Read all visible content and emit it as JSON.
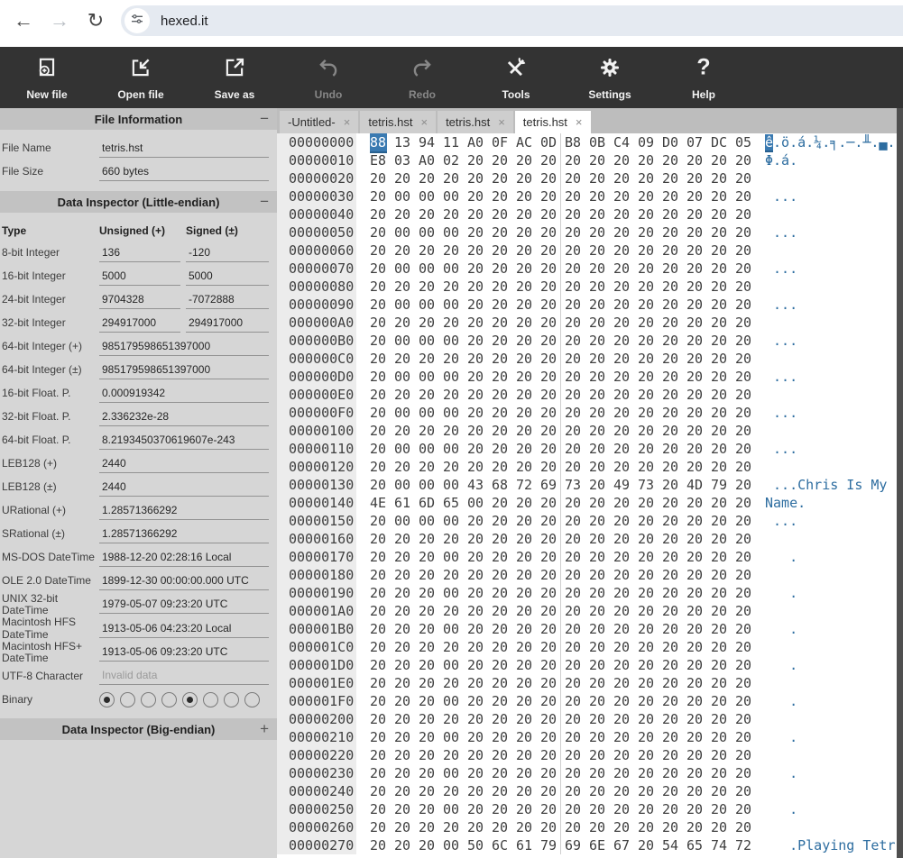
{
  "browser": {
    "url": "hexed.it"
  },
  "toolbar": {
    "buttons": [
      {
        "label": "New file",
        "icon": "new-file-icon",
        "enabled": true
      },
      {
        "label": "Open file",
        "icon": "open-file-icon",
        "enabled": true
      },
      {
        "label": "Save as",
        "icon": "save-as-icon",
        "enabled": true
      },
      {
        "label": "Undo",
        "icon": "undo-icon",
        "enabled": false
      },
      {
        "label": "Redo",
        "icon": "redo-icon",
        "enabled": false
      },
      {
        "label": "Tools",
        "icon": "tools-icon",
        "enabled": true
      },
      {
        "label": "Settings",
        "icon": "settings-icon",
        "enabled": true
      },
      {
        "label": "Help",
        "icon": "help-icon",
        "enabled": true
      }
    ]
  },
  "tabs": [
    {
      "label": "-Untitled-",
      "active": false
    },
    {
      "label": "tetris.hst",
      "active": false
    },
    {
      "label": "tetris.hst",
      "active": false
    },
    {
      "label": "tetris.hst",
      "active": true
    }
  ],
  "sidebar": {
    "file_info": {
      "title": "File Information",
      "toggle": "−",
      "rows": [
        {
          "label": "File Name",
          "value": "tetris.hst"
        },
        {
          "label": "File Size",
          "value": "660 bytes"
        }
      ]
    },
    "inspector_le": {
      "title": "Data Inspector (Little-endian)",
      "toggle": "−",
      "columns": [
        "Type",
        "Unsigned (+)",
        "Signed (±)"
      ],
      "rows": [
        {
          "label": "8-bit Integer",
          "u": "136",
          "s": "-120"
        },
        {
          "label": "16-bit Integer",
          "u": "5000",
          "s": "5000"
        },
        {
          "label": "24-bit Integer",
          "u": "9704328",
          "s": "-7072888"
        },
        {
          "label": "32-bit Integer",
          "u": "294917000",
          "s": "294917000"
        },
        {
          "label": "64-bit Integer (+)",
          "value": "985179598651397000"
        },
        {
          "label": "64-bit Integer (±)",
          "value": "985179598651397000"
        },
        {
          "label": "16-bit Float. P.",
          "value": "0.000919342"
        },
        {
          "label": "32-bit Float. P.",
          "value": "2.336232e-28"
        },
        {
          "label": "64-bit Float. P.",
          "value": "8.2193450370619607e-243"
        },
        {
          "label": "LEB128 (+)",
          "value": "2440"
        },
        {
          "label": "LEB128 (±)",
          "value": "2440"
        },
        {
          "label": "URational (+)",
          "value": "1.28571366292"
        },
        {
          "label": "SRational (±)",
          "value": "1.28571366292"
        },
        {
          "label": "MS-DOS DateTime",
          "value": "1988-12-20 02:28:16 Local"
        },
        {
          "label": "OLE 2.0 DateTime",
          "value": "1899-12-30 00:00:00.000 UTC"
        },
        {
          "label": "UNIX 32-bit DateTime",
          "value": "1979-05-07 09:23:20 UTC"
        },
        {
          "label": "Macintosh HFS DateTime",
          "value": "1913-05-06 04:23:20 Local"
        },
        {
          "label": "Macintosh HFS+ DateTime",
          "value": "1913-05-06 09:23:20 UTC"
        },
        {
          "label": "UTF-8 Character",
          "value": "Invalid data",
          "muted": true
        }
      ]
    },
    "binary": {
      "label": "Binary",
      "bits": [
        1,
        0,
        0,
        0,
        1,
        0,
        0,
        0
      ]
    },
    "inspector_be": {
      "title": "Data Inspector (Big-endian)",
      "toggle": "+"
    }
  },
  "hex_view": {
    "selection": {
      "row": 0,
      "col": 0
    },
    "colors": {
      "selection": "#3a7ab1",
      "ascii_text": "#2d6da0"
    },
    "rows": [
      [
        "00000000",
        "88 13 94 11 A0 0F AC 0D B8 0B C4 09 D0 07 DC 05",
        "ê.ö.á.¼.╕.─.╨.▄."
      ],
      [
        "00000010",
        "E8 03 A0 02 20 20 20 20 20 20 20 20 20 20 20 20",
        "Φ.á.            "
      ],
      [
        "00000020",
        "20 20 20 20 20 20 20 20 20 20 20 20 20 20 20 20",
        "                "
      ],
      [
        "00000030",
        "20 00 00 00 20 20 20 20 20 20 20 20 20 20 20 20",
        " ...            "
      ],
      [
        "00000040",
        "20 20 20 20 20 20 20 20 20 20 20 20 20 20 20 20",
        "                "
      ],
      [
        "00000050",
        "20 00 00 00 20 20 20 20 20 20 20 20 20 20 20 20",
        " ...            "
      ],
      [
        "00000060",
        "20 20 20 20 20 20 20 20 20 20 20 20 20 20 20 20",
        "                "
      ],
      [
        "00000070",
        "20 00 00 00 20 20 20 20 20 20 20 20 20 20 20 20",
        " ...            "
      ],
      [
        "00000080",
        "20 20 20 20 20 20 20 20 20 20 20 20 20 20 20 20",
        "                "
      ],
      [
        "00000090",
        "20 00 00 00 20 20 20 20 20 20 20 20 20 20 20 20",
        " ...            "
      ],
      [
        "000000A0",
        "20 20 20 20 20 20 20 20 20 20 20 20 20 20 20 20",
        "                "
      ],
      [
        "000000B0",
        "20 00 00 00 20 20 20 20 20 20 20 20 20 20 20 20",
        " ...            "
      ],
      [
        "000000C0",
        "20 20 20 20 20 20 20 20 20 20 20 20 20 20 20 20",
        "                "
      ],
      [
        "000000D0",
        "20 00 00 00 20 20 20 20 20 20 20 20 20 20 20 20",
        " ...            "
      ],
      [
        "000000E0",
        "20 20 20 20 20 20 20 20 20 20 20 20 20 20 20 20",
        "                "
      ],
      [
        "000000F0",
        "20 00 00 00 20 20 20 20 20 20 20 20 20 20 20 20",
        " ...            "
      ],
      [
        "00000100",
        "20 20 20 20 20 20 20 20 20 20 20 20 20 20 20 20",
        "                "
      ],
      [
        "00000110",
        "20 00 00 00 20 20 20 20 20 20 20 20 20 20 20 20",
        " ...            "
      ],
      [
        "00000120",
        "20 20 20 20 20 20 20 20 20 20 20 20 20 20 20 20",
        "                "
      ],
      [
        "00000130",
        "20 00 00 00 43 68 72 69 73 20 49 73 20 4D 79 20",
        " ...Chris Is My "
      ],
      [
        "00000140",
        "4E 61 6D 65 00 20 20 20 20 20 20 20 20 20 20 20",
        "Name.           "
      ],
      [
        "00000150",
        "20 00 00 00 20 20 20 20 20 20 20 20 20 20 20 20",
        " ...            "
      ],
      [
        "00000160",
        "20 20 20 20 20 20 20 20 20 20 20 20 20 20 20 20",
        "                "
      ],
      [
        "00000170",
        "20 20 20 00 20 20 20 20 20 20 20 20 20 20 20 20",
        "   .            "
      ],
      [
        "00000180",
        "20 20 20 20 20 20 20 20 20 20 20 20 20 20 20 20",
        "                "
      ],
      [
        "00000190",
        "20 20 20 00 20 20 20 20 20 20 20 20 20 20 20 20",
        "   .            "
      ],
      [
        "000001A0",
        "20 20 20 20 20 20 20 20 20 20 20 20 20 20 20 20",
        "                "
      ],
      [
        "000001B0",
        "20 20 20 00 20 20 20 20 20 20 20 20 20 20 20 20",
        "   .            "
      ],
      [
        "000001C0",
        "20 20 20 20 20 20 20 20 20 20 20 20 20 20 20 20",
        "                "
      ],
      [
        "000001D0",
        "20 20 20 00 20 20 20 20 20 20 20 20 20 20 20 20",
        "   .            "
      ],
      [
        "000001E0",
        "20 20 20 20 20 20 20 20 20 20 20 20 20 20 20 20",
        "                "
      ],
      [
        "000001F0",
        "20 20 20 00 20 20 20 20 20 20 20 20 20 20 20 20",
        "   .            "
      ],
      [
        "00000200",
        "20 20 20 20 20 20 20 20 20 20 20 20 20 20 20 20",
        "                "
      ],
      [
        "00000210",
        "20 20 20 00 20 20 20 20 20 20 20 20 20 20 20 20",
        "   .            "
      ],
      [
        "00000220",
        "20 20 20 20 20 20 20 20 20 20 20 20 20 20 20 20",
        "                "
      ],
      [
        "00000230",
        "20 20 20 00 20 20 20 20 20 20 20 20 20 20 20 20",
        "   .            "
      ],
      [
        "00000240",
        "20 20 20 20 20 20 20 20 20 20 20 20 20 20 20 20",
        "                "
      ],
      [
        "00000250",
        "20 20 20 00 20 20 20 20 20 20 20 20 20 20 20 20",
        "   .            "
      ],
      [
        "00000260",
        "20 20 20 20 20 20 20 20 20 20 20 20 20 20 20 20",
        "                "
      ],
      [
        "00000270",
        "20 20 20 00 50 6C 61 79 69 6E 67 20 54 65 74 72",
        "   .Playing Tetr"
      ]
    ]
  }
}
